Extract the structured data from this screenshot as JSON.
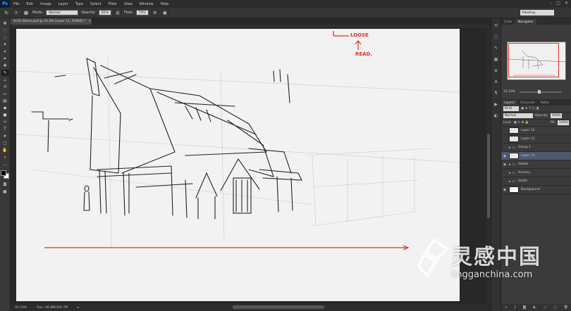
{
  "app": {
    "logo": "Ps"
  },
  "menu": [
    "File",
    "Edit",
    "Image",
    "Layer",
    "Type",
    "Select",
    "Filter",
    "View",
    "Window",
    "Help"
  ],
  "window_controls": [
    "–",
    "□",
    "✕"
  ],
  "options": {
    "mode_label": "Mode:",
    "mode_value": "Normal",
    "opacity_label": "Opacity:",
    "opacity_value": "85%",
    "flow_label": "Flow:",
    "flow_value": "75%",
    "workspace": "Painting"
  },
  "document": {
    "tab_title": "Archi Demo.psd @ 33.3% (Layer 11, RGB/8) *",
    "tab_close": "×"
  },
  "canvas_notes": {
    "note1": "LOOSE",
    "note2": "READ."
  },
  "status": {
    "zoom": "33.33%",
    "doc_info": "Doc: 48.8M/346.7M"
  },
  "panels": {
    "top_tabs": [
      "Color",
      "Navigator"
    ],
    "navigator_zoom": "33.33%",
    "layer_tabs": [
      "Layers",
      "Channels",
      "Paths"
    ],
    "kind_label": "Kind",
    "blend_mode": "Normal",
    "opacity_label": "Opacity:",
    "opacity_value": "100%",
    "lock_label": "Lock:",
    "fill_label": "Fill:",
    "fill_value": "100%",
    "layers": [
      {
        "name": "Layer 12",
        "type": "layer",
        "visible": false,
        "selected": false
      },
      {
        "name": "Layer 11",
        "type": "layer",
        "visible": false,
        "selected": false
      },
      {
        "name": "Group 1",
        "type": "group",
        "visible": false,
        "selected": false
      },
      {
        "name": "Layer 11",
        "type": "layer",
        "visible": true,
        "selected": true
      },
      {
        "name": "Stable",
        "type": "group",
        "visible": true,
        "selected": false
      },
      {
        "name": "Archery",
        "type": "group",
        "visible": false,
        "selected": false
      },
      {
        "name": "Smith",
        "type": "group",
        "visible": false,
        "selected": false
      },
      {
        "name": "Background",
        "type": "background",
        "visible": true,
        "selected": false
      }
    ],
    "footer_icons": [
      "link-icon",
      "fx-icon",
      "mask-icon",
      "adjust-icon",
      "folder-icon",
      "new-layer-icon",
      "trash-icon"
    ]
  },
  "watermark": {
    "cn": "灵感中国",
    "en": "lingganchina.com"
  },
  "colors": {
    "accent_red": "#e03020",
    "selected_layer": "#4b5a70"
  }
}
